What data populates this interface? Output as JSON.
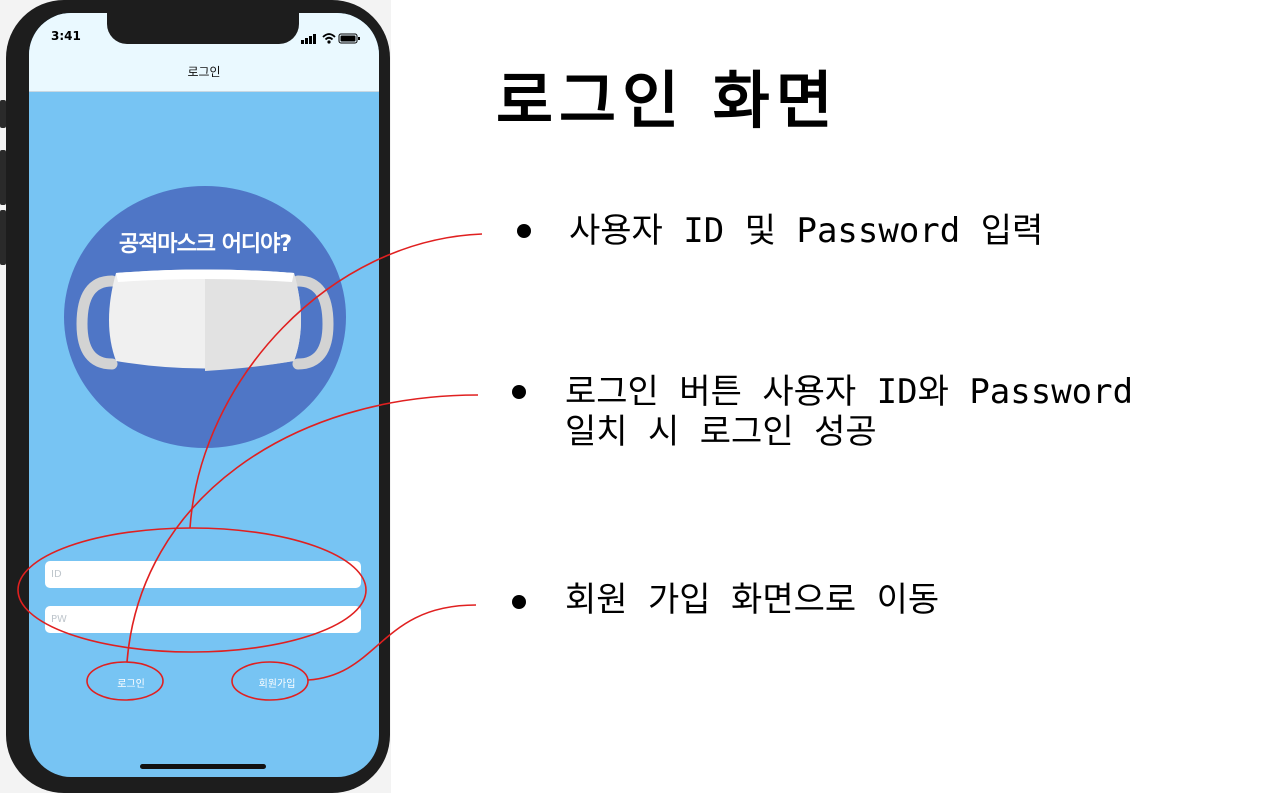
{
  "status_bar": {
    "time": "3:41"
  },
  "nav": {
    "title": "로그인"
  },
  "logo": {
    "text": "공적마스크 어디야?"
  },
  "form": {
    "id_placeholder": "ID",
    "pw_placeholder": "PW",
    "login_label": "로그인",
    "signup_label": "회원가입"
  },
  "slide": {
    "heading": "로그인 화면",
    "bullets": [
      "사용자 ID 및 Password 입력",
      "로그인 버튼 사용자 ID와 Password\n일치 시 로그인 성공",
      "회원 가입 화면으로 이동"
    ]
  },
  "colors": {
    "screen_bg": "#77c4f3",
    "logo_bg": "#4f76c6",
    "annotation": "#e02020"
  }
}
